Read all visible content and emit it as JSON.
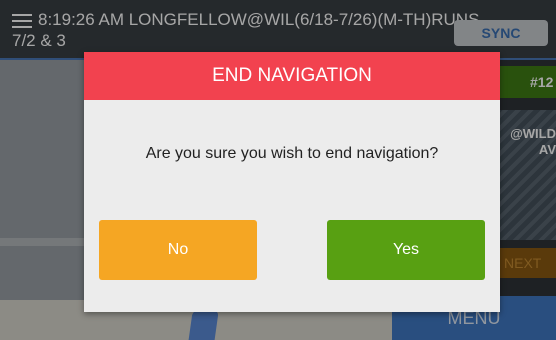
{
  "header": {
    "title": "8:19:26 AM LONGFELLOW@WIL(6/18-7/26)(M-TH)RUNS",
    "title_line2": "7/2 & 3",
    "sync_label": "SYNC"
  },
  "side_panel": {
    "route_badge": "#12",
    "stop_label": "@WILD",
    "stop_label2": "AV",
    "next_label": "NEXT",
    "menu_label": "MENU"
  },
  "dialog": {
    "title": "END NAVIGATION",
    "message": "Are you sure you wish to end navigation?",
    "no_label": "No",
    "yes_label": "Yes"
  },
  "colors": {
    "dialog_header": "#f2424f",
    "no_button": "#f5a623",
    "yes_button": "#58a012",
    "sync_text": "#3a6fb2"
  },
  "icons": [
    "hamburger-menu-icon"
  ]
}
